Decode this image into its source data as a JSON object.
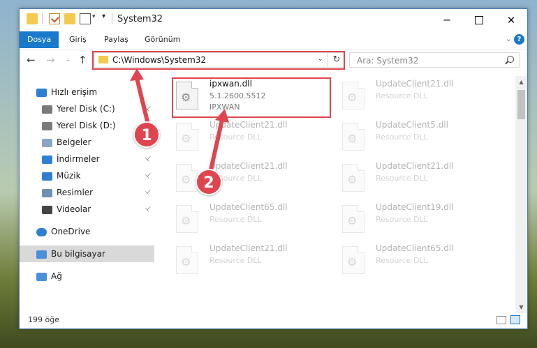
{
  "window": {
    "title": "System32",
    "controls": {
      "minimize": "─",
      "maximize": "",
      "close": "✕"
    }
  },
  "ribbon": {
    "tabs": [
      "Dosya",
      "Giriş",
      "Paylaş",
      "Görünüm"
    ],
    "help": "?"
  },
  "nav": {
    "back": "←",
    "forward": "→",
    "recent": "⌄",
    "up": "↑"
  },
  "address": {
    "path": "C:\\Windows\\System32",
    "dropdown": "⌄",
    "refresh": "↻"
  },
  "search": {
    "placeholder": "Ara: System32"
  },
  "sidebar": {
    "items": [
      {
        "label": "Hızlı erişim",
        "icon": "star-icon",
        "pinned": false
      },
      {
        "label": "Yerel Disk (C:)",
        "icon": "drive-icon",
        "pinned": true
      },
      {
        "label": "Yerel Disk (D:)",
        "icon": "drive-icon",
        "pinned": true
      },
      {
        "label": "Belgeler",
        "icon": "documents-icon",
        "pinned": true
      },
      {
        "label": "İndirmeler",
        "icon": "downloads-icon",
        "pinned": true
      },
      {
        "label": "Müzik",
        "icon": "music-icon",
        "pinned": true
      },
      {
        "label": "Resimler",
        "icon": "pictures-icon",
        "pinned": true
      },
      {
        "label": "Videolar",
        "icon": "videos-icon",
        "pinned": true
      },
      {
        "label": "OneDrive",
        "icon": "cloud-icon",
        "pinned": false
      },
      {
        "label": "Bu bilgisayar",
        "icon": "computer-icon",
        "pinned": false
      },
      {
        "label": "Ağ",
        "icon": "network-icon",
        "pinned": false
      }
    ],
    "pin_glyph": "📌"
  },
  "files": [
    {
      "name": "ipxwan.dll",
      "line2": "5.1.2600.5512",
      "line3": "IPXWAN",
      "highlighted": true
    },
    {
      "name": "UpdateClient21.dll",
      "line2": "Resource DLL",
      "line3": ""
    },
    {
      "name": "UpdateClient21.dll",
      "line2": "Resource DLL",
      "line3": ""
    },
    {
      "name": "UpdateClient5.dll",
      "line2": "Resource DLL",
      "line3": ""
    },
    {
      "name": "UpdateClient21.dll",
      "line2": "Resource DLL",
      "line3": ""
    },
    {
      "name": "UpdateClient21.dll",
      "line2": "Resource DLL",
      "line3": ""
    },
    {
      "name": "UpdateClient65.dll",
      "line2": "Resource DLL",
      "line3": ""
    },
    {
      "name": "UpdateClient19.dll",
      "line2": "Resource DLL",
      "line3": ""
    },
    {
      "name": "UpdateClient21.dll",
      "line2": "Resource DLL",
      "line3": ""
    },
    {
      "name": "UpdateClient65.dll",
      "line2": "Resource DLL",
      "line3": ""
    }
  ],
  "status": {
    "count": "199 öğe"
  },
  "annotations": {
    "badge1": "1",
    "badge2": "2"
  },
  "colors": {
    "accent": "#1979ca",
    "highlight": "#e0454f",
    "folder": "#f3c94e"
  }
}
